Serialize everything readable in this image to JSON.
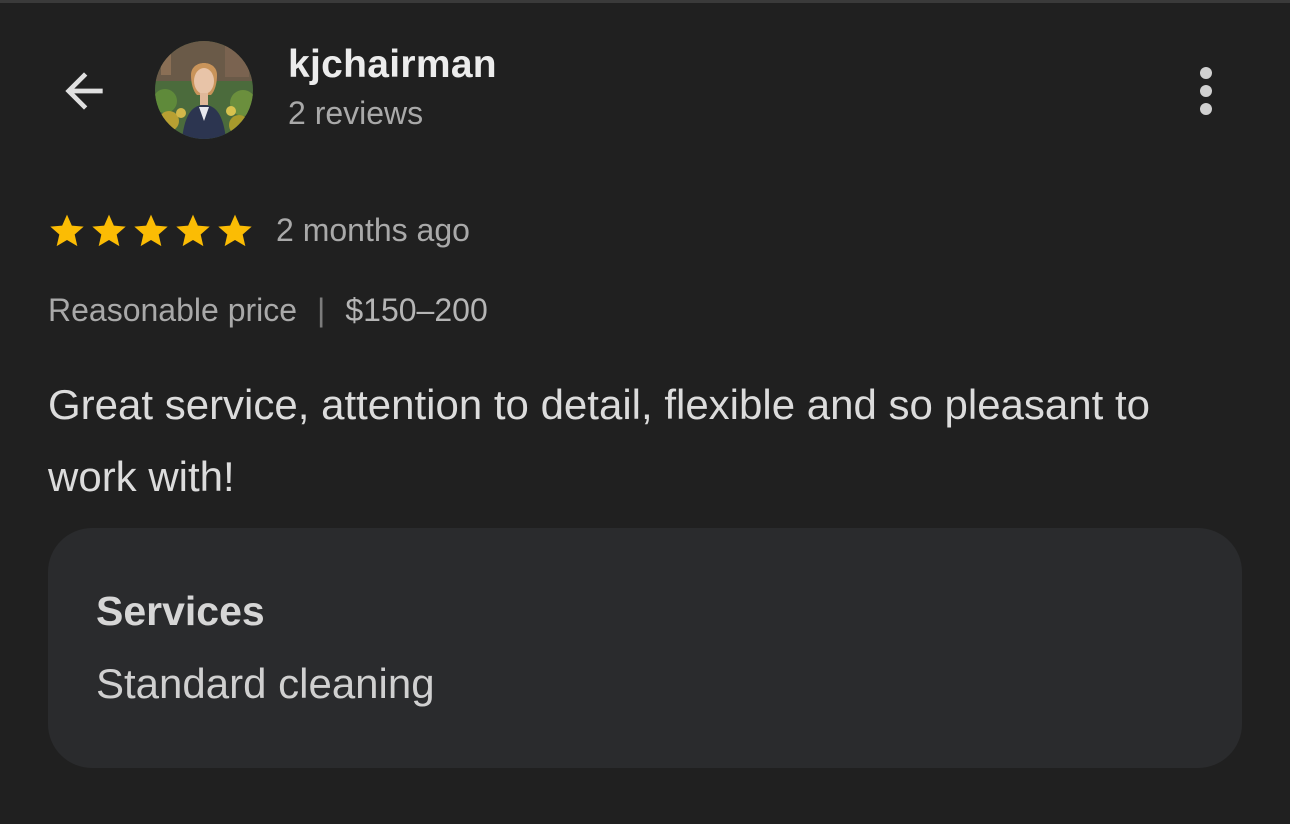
{
  "reviewer": {
    "name": "kjchairman",
    "review_count": "2 reviews"
  },
  "review": {
    "rating": 5,
    "max_rating": 5,
    "date": "2 months ago",
    "price_label": "Reasonable price",
    "price_separator": "|",
    "price_range": "$150–200",
    "text": "Great service, attention to detail, flexible and so pleasant to work with!"
  },
  "services": {
    "title": "Services",
    "value": "Standard cleaning"
  },
  "icons": {
    "back": "arrow-back-icon",
    "more": "more-vertical-icon",
    "star": "star-icon"
  },
  "colors": {
    "background": "#202020",
    "card": "#2a2b2d",
    "star": "#fbbc04",
    "primary_text": "#ececec",
    "secondary_text": "#a9a9a9"
  }
}
